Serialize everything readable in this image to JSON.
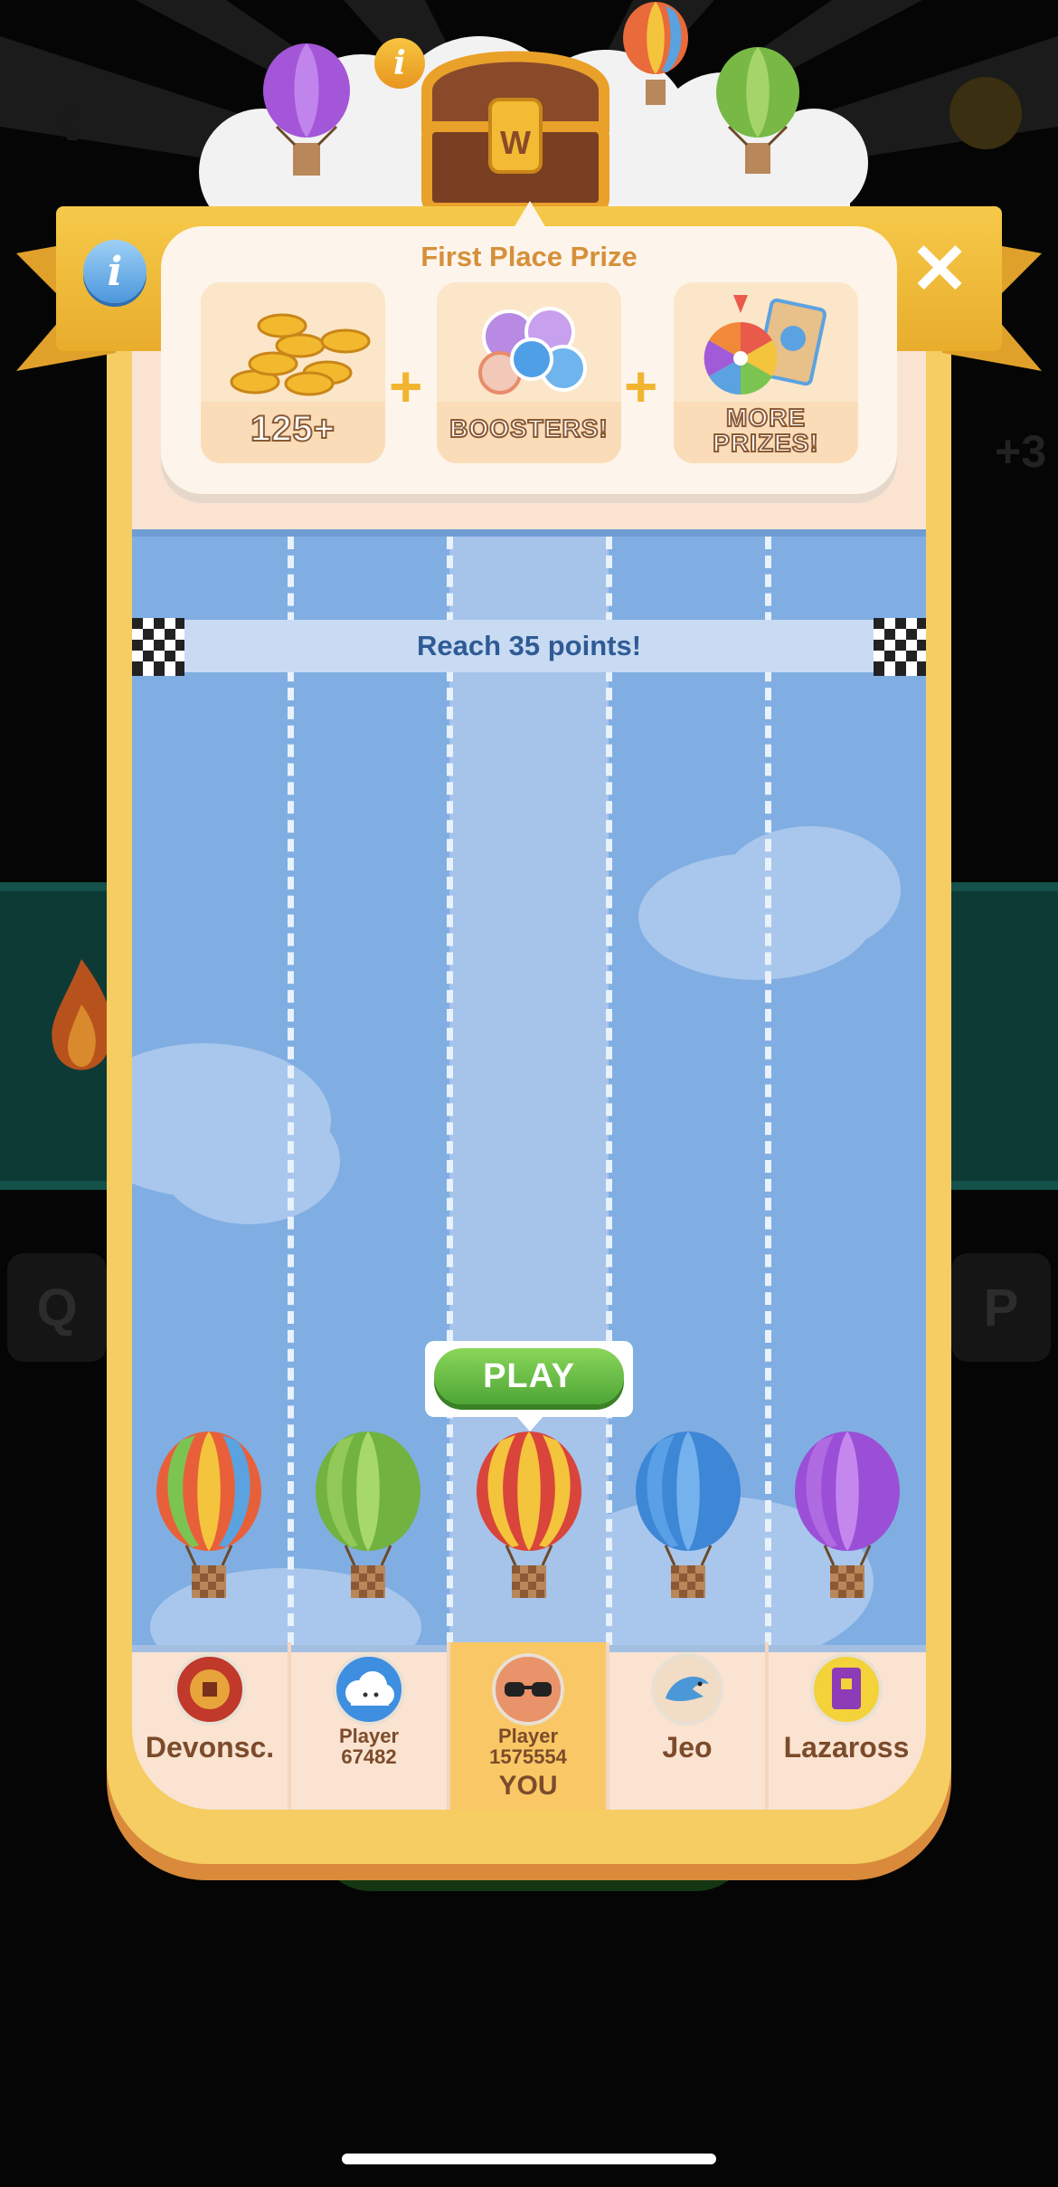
{
  "colors": {
    "modal_frame": "#f5cd63",
    "modal_inner": "#fae3d1",
    "race_sky": "#80aee2",
    "prize_title": "#d6903a",
    "play_button": "#5cb53d",
    "text_brown": "#7b4b2b",
    "finish_text": "#2f5b95"
  },
  "header": {
    "chest_info_icon": "i",
    "info_icon": "i",
    "close_icon": "✕"
  },
  "prize": {
    "title": "First Place Prize",
    "items": [
      {
        "label": "125+",
        "icon": "coin-stack-icon"
      },
      {
        "label": "BOOSTERS!",
        "icon": "boosters-icon"
      },
      {
        "label_line1": "MORE",
        "label_line2": "PRIZES!",
        "icon": "prize-wheel-icon"
      }
    ],
    "plus": "+"
  },
  "race": {
    "goal_text": "Reach 35 points!",
    "play_label": "PLAY"
  },
  "players": [
    {
      "name": "Devonsc.",
      "avatar": "coin-avatar",
      "balloon": "rainbow"
    },
    {
      "name_line1": "Player",
      "name_line2": "67482",
      "avatar": "cloud-avatar",
      "balloon": "green"
    },
    {
      "name_line1": "Player",
      "name_line2": "1575554",
      "avatar": "glasses-avatar",
      "balloon": "red-yellow",
      "you_label": "YOU"
    },
    {
      "name": "Jeo",
      "avatar": "dolphin-avatar",
      "balloon": "blue"
    },
    {
      "name": "Lazaross",
      "avatar": "book-avatar",
      "balloon": "purple"
    }
  ],
  "background": {
    "keys": [
      "Q",
      "P"
    ]
  }
}
